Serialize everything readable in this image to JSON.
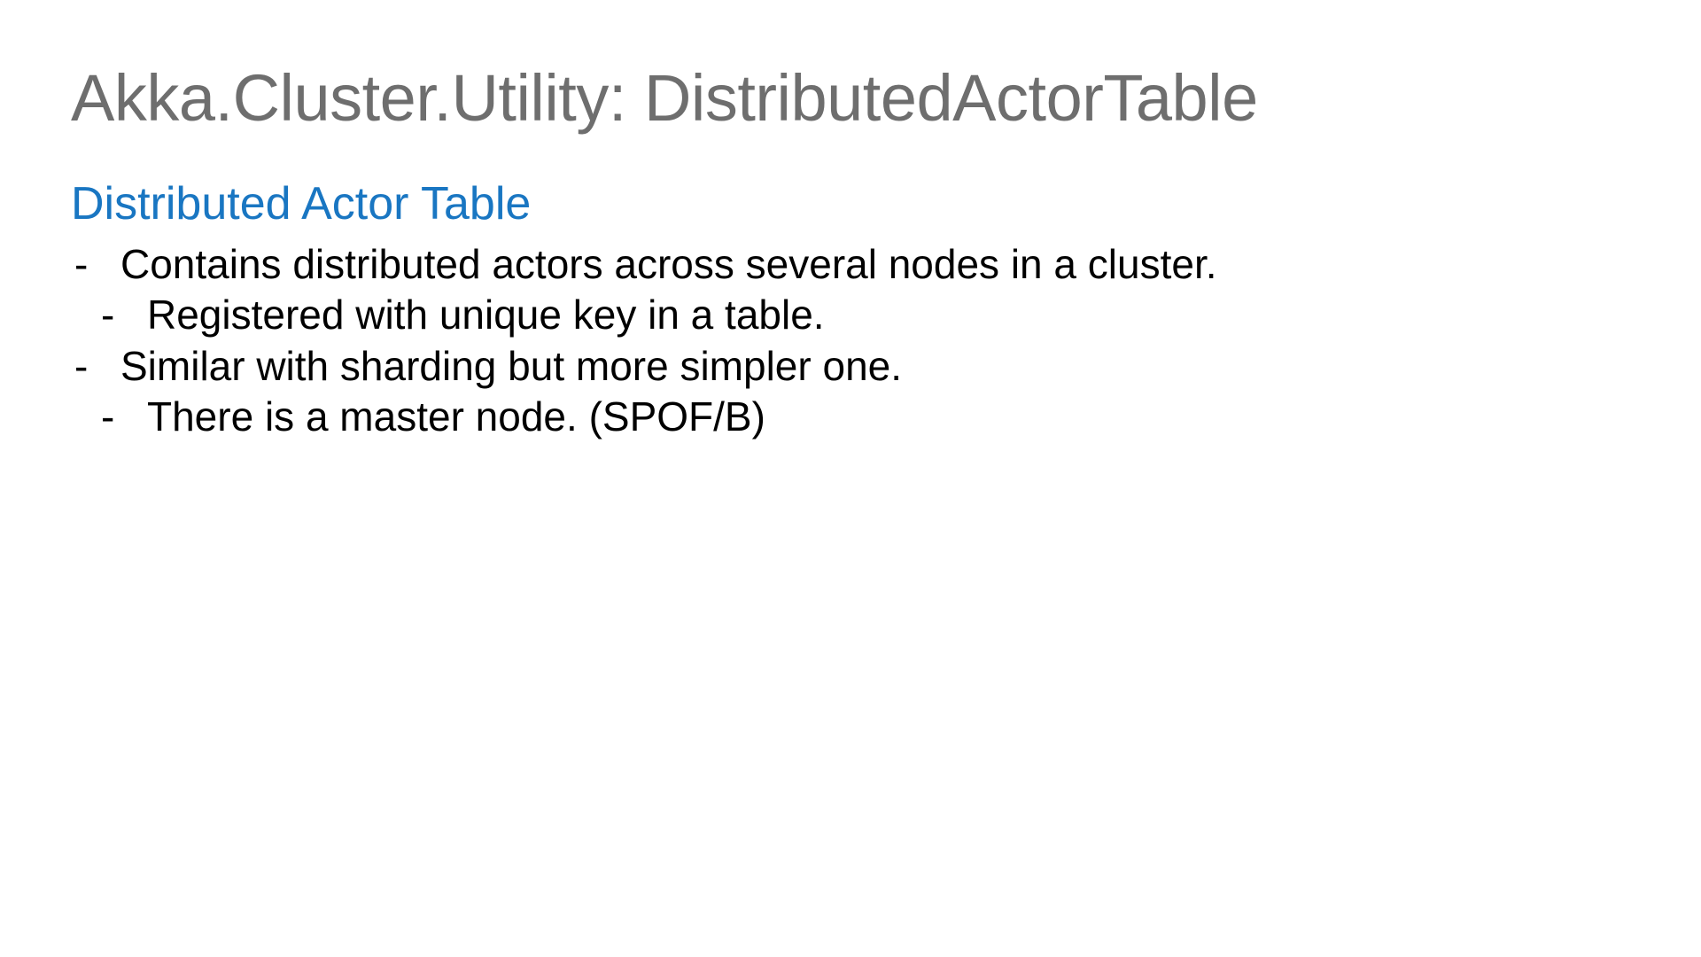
{
  "slide": {
    "title": "Akka.Cluster.Utility: DistributedActorTable",
    "subtitle": "Distributed Actor Table",
    "bullets": [
      {
        "level": 1,
        "text": "Contains distributed actors across several nodes in a cluster."
      },
      {
        "level": 2,
        "text": "Registered with unique key in a table."
      },
      {
        "level": 1,
        "text": "Similar with sharding but more simpler one."
      },
      {
        "level": 2,
        "text": "There is a master node. (SPOF/B)"
      }
    ],
    "dash": "-"
  }
}
